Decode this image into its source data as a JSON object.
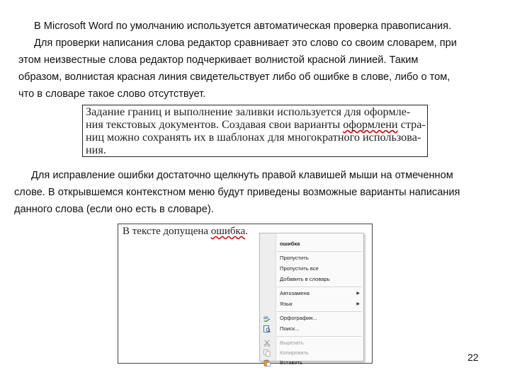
{
  "intro": {
    "lines": [
      "В Microsoft Word по умолчанию используется автоматическая проверка правописания.",
      "Для проверки написания слова редактор сравнивает это слово со своим словарем, при",
      "этом неизвестные слова редактор подчеркивает волнистой красной линией. Таким",
      "образом, волнистая красная линия  свидетельствует либо об ошибке в слове, либо о том,",
      "что в словаре такое слово отсутствует."
    ]
  },
  "example1": {
    "line1": "Задание границ и выполнение заливки используется для оформле-",
    "line2_before": "ния текстовых документов. Создавая свои варианты ",
    "line2_error": "оформлени",
    "line2_after": " стра-",
    "line3": "ниц можно сохранять их в шаблонах для многократного использова-",
    "line4": "ния."
  },
  "instructions": {
    "lines": [
      "Для исправление ошибки достаточно щелкнуть правой клавишей мыши на отмеченном",
      "слове. В открывшемся контекстном меню будут приведены возможные варианты написания",
      "данного слова (если оно есть в словаре)."
    ]
  },
  "example2": {
    "text_before": "В тексте допущена ",
    "text_error": "ошибка",
    "text_after": "."
  },
  "context_menu": {
    "items": [
      {
        "label": "ошибка",
        "icon": "",
        "submenu": false,
        "disabled": false,
        "bold": true
      },
      {
        "label": "Пропустить",
        "icon": "",
        "submenu": false,
        "disabled": false
      },
      {
        "label": "Пропустить все",
        "icon": "",
        "submenu": false,
        "disabled": false
      },
      {
        "label": "Добавить в словарь",
        "icon": "",
        "submenu": false,
        "disabled": false
      },
      {
        "label": "Автозамена",
        "icon": "",
        "submenu": true,
        "disabled": false
      },
      {
        "label": "Язык",
        "icon": "",
        "submenu": true,
        "disabled": false
      },
      {
        "label": "Орфография...",
        "icon": "spelling-icon",
        "submenu": false,
        "disabled": false
      },
      {
        "label": "Поиск...",
        "icon": "research-icon",
        "submenu": false,
        "disabled": false
      },
      {
        "label": "Вырезать",
        "icon": "cut-icon",
        "submenu": false,
        "disabled": true
      },
      {
        "label": "Копировать",
        "icon": "copy-icon",
        "submenu": false,
        "disabled": true
      },
      {
        "label": "Вставить",
        "icon": "paste-icon",
        "submenu": false,
        "disabled": false
      }
    ]
  },
  "page_number": "22"
}
